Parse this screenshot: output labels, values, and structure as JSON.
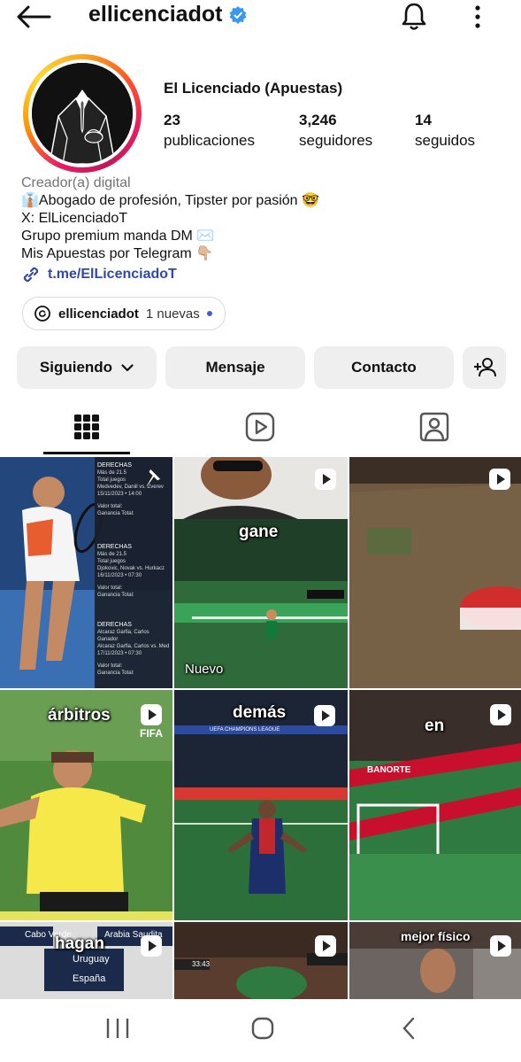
{
  "header": {
    "username": "ellicenciadot"
  },
  "profile": {
    "display_name": "El Licenciado (Apuestas)",
    "stats": [
      {
        "value": "23",
        "label": "publicaciones"
      },
      {
        "value": "3,246",
        "label": "seguidores"
      },
      {
        "value": "14",
        "label": "seguidos"
      }
    ],
    "category": "Creador(a) digital",
    "bio_lines": [
      "👔Abogado de profesión, Tipster por pasión 🤓",
      "X: ElLicenciadoT",
      "Grupo premium manda DM ✉️",
      "Mis Apuestas por Telegram 👇🏼"
    ],
    "link": "t.me/ElLicenciadoT",
    "threads_handle": "ellicenciadot",
    "threads_new": "1 nuevas"
  },
  "actions": {
    "following": "Siguiendo",
    "message": "Mensaje",
    "contact": "Contacto"
  },
  "tabs": [
    "grid-icon",
    "reels-icon",
    "tagged-icon"
  ],
  "posts": [
    {
      "caption": "",
      "reel": false,
      "pinned": true,
      "bet_cards": [
        {
          "title": "DERECHAS",
          "line1": "Más de 21.5",
          "line2": "Total juegos",
          "line3": "Medvedev, Daniil vs. Zverev",
          "line4": "15/11/2023 • 14:00",
          "v1": "Valor total:",
          "v2": "Ganancia Total:"
        },
        {
          "title": "DERECHAS",
          "line1": "Más de 21.5",
          "line2": "Total juegos",
          "line3": "Djokovic, Novak vs. Hurkacz",
          "line4": "16/11/2023 • 07:30",
          "v1": "Valor total:",
          "v2": "Ganancia Total:"
        },
        {
          "title": "DERECHAS",
          "line1": "Alcaraz Garfia, Carlos",
          "line2": "Ganador",
          "line3": "Alcaraz Garfia, Carlos vs. Med",
          "line4": "17/11/2023 • 07:30",
          "v1": "Valor total:",
          "v2": "Ganancia Total:"
        }
      ]
    },
    {
      "caption": "gane",
      "reel": true,
      "badge": "Nuevo"
    },
    {
      "caption": "",
      "reel": true
    },
    {
      "caption": "árbitros",
      "reel": true,
      "watermark": "FIFA"
    },
    {
      "caption": "demás",
      "reel": true,
      "banner": "UEFA CHAMPIONS LEAGUE"
    },
    {
      "caption": "en",
      "reel": true,
      "sponsor": "BANORTE"
    },
    {
      "caption": "hagan",
      "reel": true,
      "teams": [
        "Cabo Verde",
        "Arabia Saudita",
        "Uruguay",
        "España"
      ]
    },
    {
      "caption": "",
      "reel": true,
      "score_time": "33:43"
    },
    {
      "caption": "mejor físico",
      "reel": true
    }
  ],
  "colors": {
    "verified": "#3897f0",
    "link": "#2f4aa8",
    "button_bg": "#efefef"
  }
}
